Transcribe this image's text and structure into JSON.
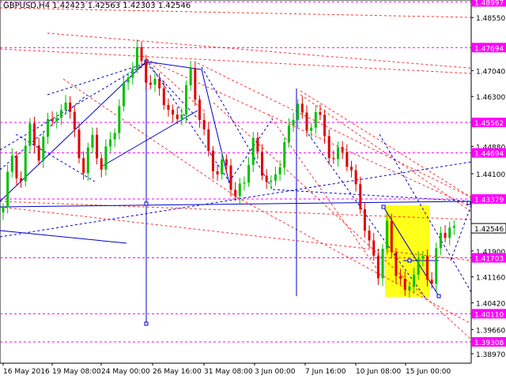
{
  "chart_data": {
    "type": "candlestick",
    "title": "GBPUSD,H4  1.42423 1.42563 1.42303 1.42546",
    "symbol": "GBPUSD",
    "timeframe": "H4",
    "ohlc_last": {
      "open": 1.42423,
      "high": 1.42563,
      "low": 1.42303,
      "close": 1.42546
    },
    "colors": {
      "bull": "#00c000",
      "bear": "#e00000",
      "level": "#ff00ff",
      "trend": "#0000cc",
      "channel": "#ff0000",
      "zone": "#ffff00",
      "current_tag": "#ffffff"
    },
    "y_ticks": [
      "1.48550",
      "1.47040",
      "1.46300",
      "1.44880",
      "1.44100",
      "1.42620",
      "1.41900",
      "1.41160",
      "1.40420",
      "1.39660",
      "1.38970"
    ],
    "x_ticks": [
      "16 May 2016",
      "19 May 08:00",
      "24 May 00:00",
      "26 May 16:00",
      "31 May 08:00",
      "3 Jun 00:00",
      "7 Jun 16:00",
      "10 Jun 08:00",
      "15 Jun 00:00"
    ],
    "levels": [
      "1.48997",
      "1.47694",
      "1.45562",
      "1.44694",
      "1.43379",
      "1.41703",
      "1.40110",
      "1.39308"
    ],
    "current_price": "1.42546",
    "ylim": [
      1.387,
      1.4905
    ],
    "price_series": [
      1.43,
      1.447,
      1.439,
      1.456,
      1.442,
      1.46,
      1.455,
      1.462,
      1.452,
      1.444,
      1.45,
      1.442,
      1.452,
      1.46,
      1.468,
      1.476,
      1.47,
      1.465,
      1.462,
      1.457,
      1.46,
      1.468,
      1.458,
      1.448,
      1.44,
      1.443,
      1.435,
      1.44,
      1.448,
      1.443,
      1.438,
      1.444,
      1.452,
      1.464,
      1.452,
      1.458,
      1.452,
      1.446,
      1.447,
      1.44,
      1.434,
      1.42,
      1.412,
      1.426,
      1.415,
      1.405,
      1.413,
      1.418,
      1.41,
      1.423,
      1.4255
    ]
  }
}
